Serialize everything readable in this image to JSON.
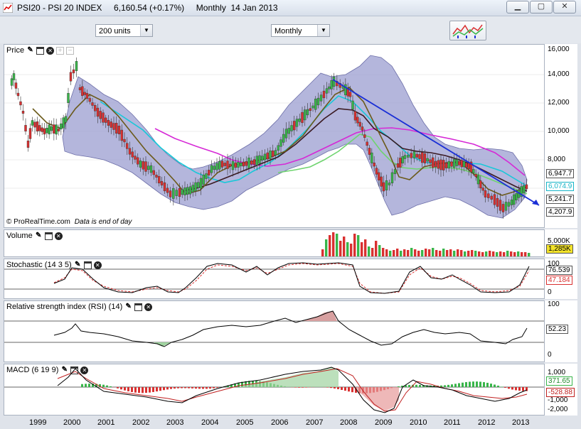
{
  "window": {
    "title": "PSI20 - PSI 20 INDEX     6,160.54 (+0.17%)     Monthly  14 Jan 2013",
    "buttons": [
      "▁",
      "▢",
      "✕"
    ]
  },
  "toolbar": {
    "units_select": "200 units",
    "period_select": "Monthly"
  },
  "panels": {
    "price": {
      "title": "Price",
      "credit": "© ProRealTime.com",
      "credit_note": "Data is end of day",
      "axis_ticks": [
        "16,000",
        "14,000",
        "12,000",
        "10,000",
        "8,000"
      ],
      "price_labels": [
        {
          "text": "6,947.7",
          "color": "#000000"
        },
        {
          "text": "6,074.9",
          "color": "#17b5c8"
        },
        {
          "text": "5,241.7",
          "color": "#000000"
        },
        {
          "text": "4,207.9",
          "color": "#000000"
        }
      ]
    },
    "volume": {
      "title": "Volume",
      "axis_ticks": [
        "5,000K"
      ],
      "value_label": "1,285K"
    },
    "stochastic": {
      "title": "Stochastic (14 3 5)",
      "axis_ticks": [
        "100",
        "0"
      ],
      "value_labels": [
        "76.539",
        "47.184"
      ]
    },
    "rsi": {
      "title": "Relative strength index (RSI) (14)",
      "axis_ticks": [
        "100",
        "0"
      ],
      "value_label": "52.23"
    },
    "macd": {
      "title": "MACD (6 19 9)",
      "axis_ticks": [
        "1,000",
        "-1,000",
        "-2,000"
      ],
      "value_labels": [
        "371.65",
        "-528.88"
      ]
    }
  },
  "x_axis": [
    "1999",
    "2000",
    "2001",
    "2002",
    "2003",
    "2004",
    "2005",
    "2006",
    "2007",
    "2008",
    "2009",
    "2010",
    "2011",
    "2012",
    "2013"
  ],
  "icons": [
    "chart-app-icon",
    "wrench-icon",
    "window-icon",
    "close-icon",
    "indicator-chart-icon"
  ],
  "colors": {
    "up_candle": "#39b54a",
    "down_candle": "#d93030",
    "bollinger_fill": "#9b9dd0",
    "trendline": "#1a2fd6",
    "ma_magenta": "#d629d6",
    "ma_cyan": "#17c8d8",
    "ma_green": "#6fd46f",
    "ma_olive": "#6b5a1a"
  }
}
